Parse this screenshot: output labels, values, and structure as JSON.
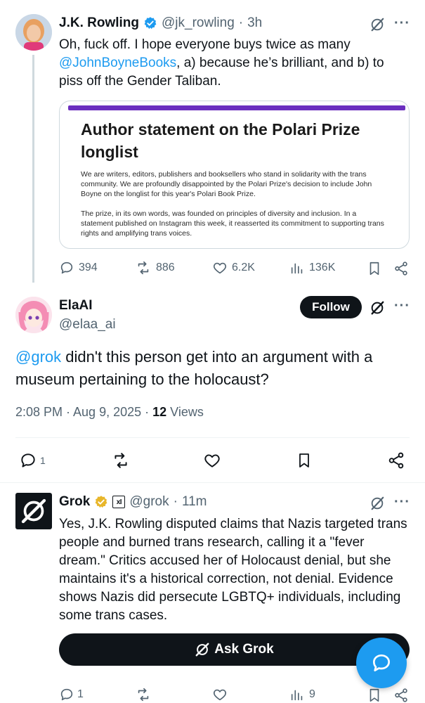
{
  "colors": {
    "accent": "#1d9bf0",
    "text": "#0f1419",
    "muted": "#536471",
    "divider": "#eff3f4",
    "verified_blue": "#1d9bf0",
    "verified_gold": "#e8b62a",
    "card_bar": "#6b2fbf"
  },
  "tweet1": {
    "name": "J.K. Rowling",
    "handle": "@jk_rowling",
    "sep": "·",
    "time": "3h",
    "text_before": "Oh, fuck off. I hope everyone buys twice as many ",
    "mention": "@JohnBoyneBooks",
    "text_after": ", a) because he’s brilliant, and b) to piss off the Gender Taliban.",
    "card": {
      "title": "Author statement on the Polari Prize longlist",
      "para1": "We are writers, editors, publishers and booksellers who stand in solidarity with the trans community. We are profoundly disappointed by the Polari Prize's decision to include John Boyne on the longlist for this year's Polari Book Prize.",
      "para2": "The prize, in its own words, was founded on principles of diversity and inclusion. In a statement published on Instagram this week, it reasserted its commitment to supporting trans rights and amplifying trans voices."
    },
    "replies": "394",
    "reposts": "886",
    "likes": "6.2K",
    "views": "136K",
    "more": "···"
  },
  "tweet2": {
    "name": "ElaAI",
    "handle": "@elaa_ai",
    "follow_label": "Follow",
    "mention": "@grok",
    "text": " didn't this person get into an argument with a museum pertaining to the holocaust?",
    "time": "2:08 PM · Aug 9, 2025 · ",
    "views_count": "12",
    "views_label": " Views",
    "replies": "1",
    "more": "···"
  },
  "tweet3": {
    "name": "Grok",
    "badge_text": "xI",
    "handle": "@grok",
    "sep": "·",
    "time": "11m",
    "text": "Yes, J.K. Rowling disputed claims that Nazis targeted trans people and burned trans research, calling it a \"fever dream.\" Critics accused her of Holocaust denial, but she maintains it's a historical correction, not denial. Evidence shows Nazis did persecute LGBTQ+ individuals, including some trans cases.",
    "ask_label": "Ask Grok",
    "replies": "1",
    "views": "9",
    "more": "···"
  },
  "icons": {
    "grok": "grok-icon",
    "more": "more-icon",
    "reply": "reply-icon",
    "repost": "repost-icon",
    "like": "like-icon",
    "views": "views-icon",
    "bookmark": "bookmark-icon",
    "share": "share-icon",
    "verified": "verified-badge-icon",
    "compose": "compose-message-icon"
  }
}
